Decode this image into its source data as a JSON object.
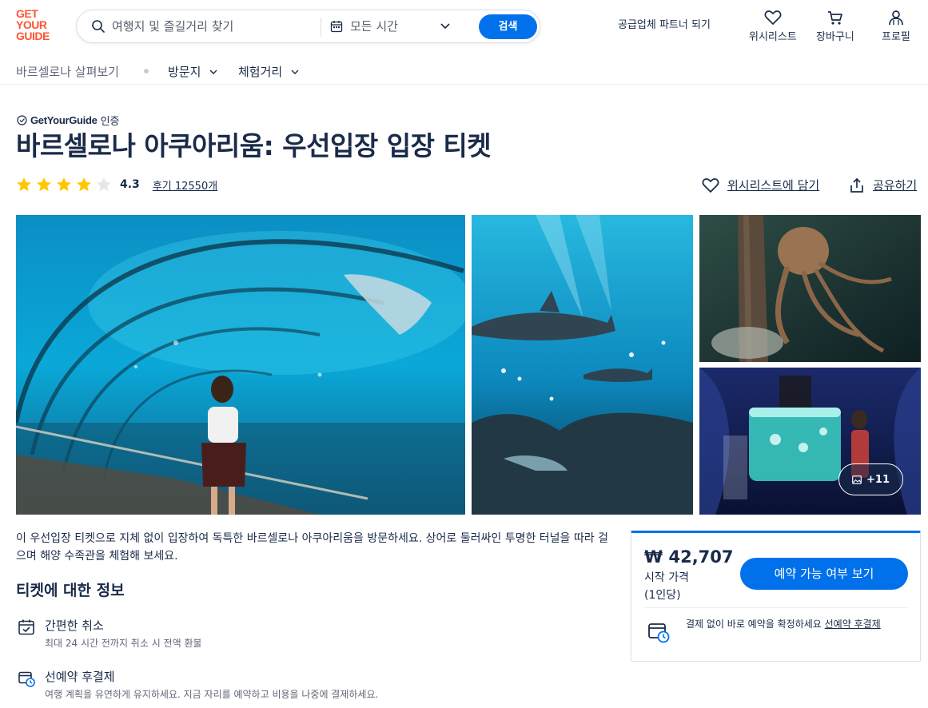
{
  "header": {
    "logo": [
      "GET",
      "YOUR",
      "GUIDE"
    ],
    "search_placeholder": "여행지 및 즐길거리 찾기",
    "time_select": "모든 시간",
    "search_button": "검색",
    "partner_link": "공급업체 파트너 되기",
    "wishlist": "위시리스트",
    "cart": "장바구니",
    "profile": "프로필",
    "brand_color": "#ff5533",
    "accent_color": "#0071eb"
  },
  "subnav": {
    "explore": "바르셀로나 살펴보기",
    "places": "방문지",
    "things": "체험거리"
  },
  "product": {
    "certified_brand": "GetYourGuide",
    "certified_suffix": "인증",
    "title": "바르셀로나 아쿠아리움: 우선입장 입장 티켓",
    "rating": "4.3",
    "rating_stars": 4.3,
    "reviews": "후기 12550개",
    "wishlist_action": "위시리스트에 담기",
    "share_action": "공유하기"
  },
  "gallery": {
    "more_count": "+11"
  },
  "description": "이 우선입장 티켓으로 지체 없이 입장하여 독특한 바르셀로나 아쿠아리움을 방문하세요. 상어로 둘러싸인 투명한 터널을 따라 걸으며 해양 수족관을 체험해 보세요.",
  "ticket_info": {
    "heading": "티켓에 대한 정보",
    "features": [
      {
        "title": "간편한 취소",
        "sub": "최대 24 시간 전까지 취소 시 전액 환불"
      },
      {
        "title": "선예약 후결제",
        "sub": "여행 계획을 유연하게 유지하세요. 지금 자리를 예약하고 비용을 나중에 결제하세요."
      }
    ]
  },
  "booking": {
    "price": "₩ 42,707",
    "price_label_1": "시작 가격",
    "price_label_2": "(1인당)",
    "button": "예약 가능 여부 보기",
    "pay_text": "결제 없이 바로 예약을 확정하세요 ",
    "pay_link": "선예약 후결제"
  }
}
